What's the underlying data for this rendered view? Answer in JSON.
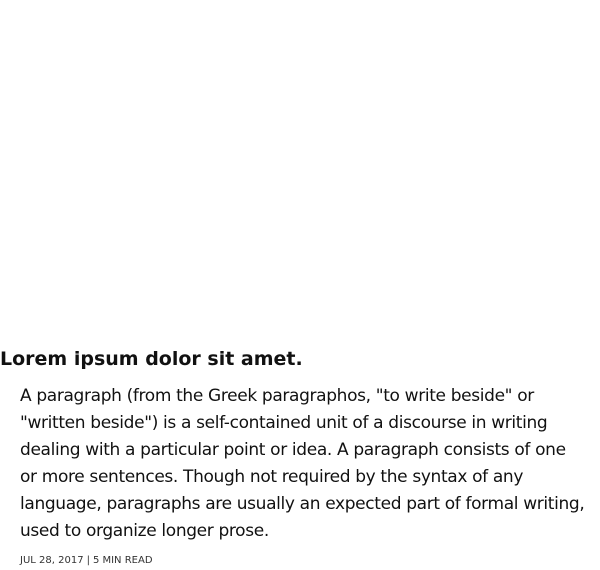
{
  "article": {
    "title": "Lorem ipsum dolor sit amet.",
    "paragraph": "A paragraph (from the Greek paragraphos, \"to write beside\" or \"written beside\") is a self-contained unit of a discourse in writing dealing with a particular point or idea. A paragraph consists of one or more sentences. Though not required by the syntax of any language, paragraphs are usually an expected part of formal writing, used to organize longer prose.",
    "date": "JUL 28, 2017",
    "separator": "|",
    "read_time": "5 MIN READ"
  }
}
